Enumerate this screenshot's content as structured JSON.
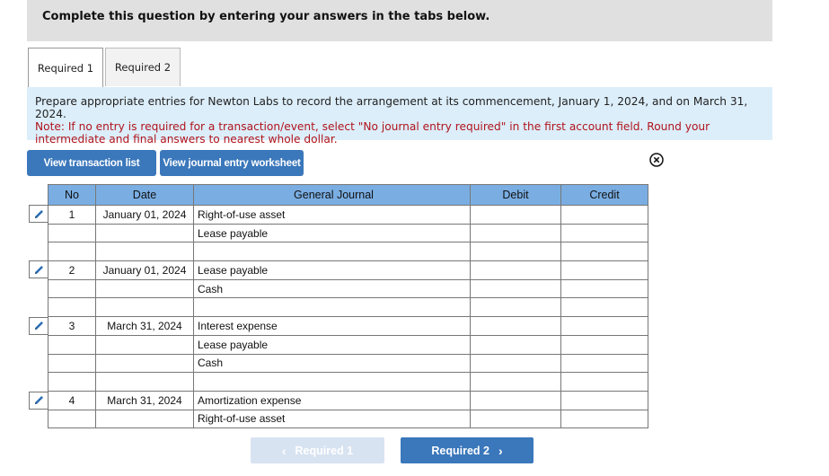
{
  "banner": {
    "text": "Complete this question by entering your answers in the tabs below."
  },
  "tabs": [
    {
      "label": "Required 1",
      "active": true
    },
    {
      "label": "Required 2",
      "active": false
    }
  ],
  "instructions": {
    "main": "Prepare appropriate entries for Newton Labs to record the arrangement at its commencement, January 1, 2024, and on March 31, 2024.",
    "note": "Note: If no entry is required for a transaction/event, select \"No journal entry required\" in the first account field. Round your intermediate and final answers to nearest whole dollar."
  },
  "buttons": {
    "view_transaction_list": "View transaction list",
    "view_journal_worksheet": "View journal entry worksheet"
  },
  "close_icon": "close-circle-icon",
  "journal": {
    "headers": {
      "no": "No",
      "date": "Date",
      "account": "General Journal",
      "debit": "Debit",
      "credit": "Credit"
    },
    "rows": [
      {
        "no": "1",
        "date": "January 01, 2024",
        "account": "Right-of-use asset",
        "debit": "",
        "credit": "",
        "edit": true
      },
      {
        "no": "",
        "date": "",
        "account": "Lease payable",
        "debit": "",
        "credit": ""
      },
      {
        "no": "",
        "date": "",
        "account": "",
        "debit": "",
        "credit": ""
      },
      {
        "no": "2",
        "date": "January 01, 2024",
        "account": "Lease payable",
        "debit": "",
        "credit": "",
        "edit": true
      },
      {
        "no": "",
        "date": "",
        "account": "Cash",
        "debit": "",
        "credit": ""
      },
      {
        "no": "",
        "date": "",
        "account": "",
        "debit": "",
        "credit": ""
      },
      {
        "no": "3",
        "date": "March 31, 2024",
        "account": "Interest expense",
        "debit": "",
        "credit": "",
        "edit": true
      },
      {
        "no": "",
        "date": "",
        "account": "Lease payable",
        "debit": "",
        "credit": ""
      },
      {
        "no": "",
        "date": "",
        "account": "Cash",
        "debit": "",
        "credit": ""
      },
      {
        "no": "",
        "date": "",
        "account": "",
        "debit": "",
        "credit": ""
      },
      {
        "no": "4",
        "date": "March 31, 2024",
        "account": "Amortization expense",
        "debit": "",
        "credit": "",
        "edit": true
      },
      {
        "no": "",
        "date": "",
        "account": "Right-of-use asset",
        "debit": "",
        "credit": ""
      }
    ]
  },
  "navigation": {
    "prev_label": "Required 1",
    "next_label": "Required 2",
    "prev_chevron": "‹",
    "next_chevron": "›"
  },
  "colors": {
    "accent": "#3a77bb",
    "header_blue": "#7aaee3",
    "note_red": "#b0141c",
    "instr_bg": "#dceefa"
  }
}
